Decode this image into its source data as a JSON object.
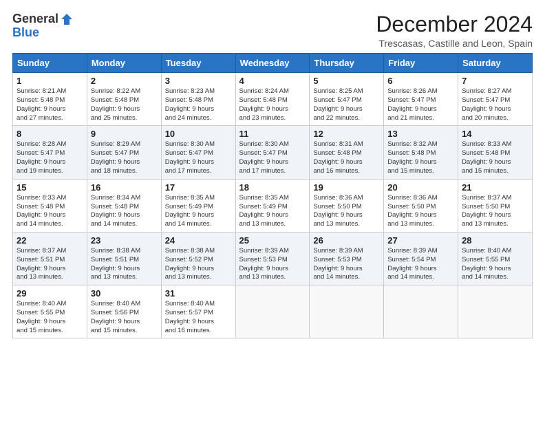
{
  "logo": {
    "general": "General",
    "blue": "Blue"
  },
  "title": "December 2024",
  "subtitle": "Trescasas, Castille and Leon, Spain",
  "weekdays": [
    "Sunday",
    "Monday",
    "Tuesday",
    "Wednesday",
    "Thursday",
    "Friday",
    "Saturday"
  ],
  "weeks": [
    [
      {
        "day": "1",
        "lines": [
          "Sunrise: 8:21 AM",
          "Sunset: 5:48 PM",
          "Daylight: 9 hours",
          "and 27 minutes."
        ]
      },
      {
        "day": "2",
        "lines": [
          "Sunrise: 8:22 AM",
          "Sunset: 5:48 PM",
          "Daylight: 9 hours",
          "and 25 minutes."
        ]
      },
      {
        "day": "3",
        "lines": [
          "Sunrise: 8:23 AM",
          "Sunset: 5:48 PM",
          "Daylight: 9 hours",
          "and 24 minutes."
        ]
      },
      {
        "day": "4",
        "lines": [
          "Sunrise: 8:24 AM",
          "Sunset: 5:48 PM",
          "Daylight: 9 hours",
          "and 23 minutes."
        ]
      },
      {
        "day": "5",
        "lines": [
          "Sunrise: 8:25 AM",
          "Sunset: 5:47 PM",
          "Daylight: 9 hours",
          "and 22 minutes."
        ]
      },
      {
        "day": "6",
        "lines": [
          "Sunrise: 8:26 AM",
          "Sunset: 5:47 PM",
          "Daylight: 9 hours",
          "and 21 minutes."
        ]
      },
      {
        "day": "7",
        "lines": [
          "Sunrise: 8:27 AM",
          "Sunset: 5:47 PM",
          "Daylight: 9 hours",
          "and 20 minutes."
        ]
      }
    ],
    [
      {
        "day": "8",
        "lines": [
          "Sunrise: 8:28 AM",
          "Sunset: 5:47 PM",
          "Daylight: 9 hours",
          "and 19 minutes."
        ]
      },
      {
        "day": "9",
        "lines": [
          "Sunrise: 8:29 AM",
          "Sunset: 5:47 PM",
          "Daylight: 9 hours",
          "and 18 minutes."
        ]
      },
      {
        "day": "10",
        "lines": [
          "Sunrise: 8:30 AM",
          "Sunset: 5:47 PM",
          "Daylight: 9 hours",
          "and 17 minutes."
        ]
      },
      {
        "day": "11",
        "lines": [
          "Sunrise: 8:30 AM",
          "Sunset: 5:47 PM",
          "Daylight: 9 hours",
          "and 17 minutes."
        ]
      },
      {
        "day": "12",
        "lines": [
          "Sunrise: 8:31 AM",
          "Sunset: 5:48 PM",
          "Daylight: 9 hours",
          "and 16 minutes."
        ]
      },
      {
        "day": "13",
        "lines": [
          "Sunrise: 8:32 AM",
          "Sunset: 5:48 PM",
          "Daylight: 9 hours",
          "and 15 minutes."
        ]
      },
      {
        "day": "14",
        "lines": [
          "Sunrise: 8:33 AM",
          "Sunset: 5:48 PM",
          "Daylight: 9 hours",
          "and 15 minutes."
        ]
      }
    ],
    [
      {
        "day": "15",
        "lines": [
          "Sunrise: 8:33 AM",
          "Sunset: 5:48 PM",
          "Daylight: 9 hours",
          "and 14 minutes."
        ]
      },
      {
        "day": "16",
        "lines": [
          "Sunrise: 8:34 AM",
          "Sunset: 5:48 PM",
          "Daylight: 9 hours",
          "and 14 minutes."
        ]
      },
      {
        "day": "17",
        "lines": [
          "Sunrise: 8:35 AM",
          "Sunset: 5:49 PM",
          "Daylight: 9 hours",
          "and 14 minutes."
        ]
      },
      {
        "day": "18",
        "lines": [
          "Sunrise: 8:35 AM",
          "Sunset: 5:49 PM",
          "Daylight: 9 hours",
          "and 13 minutes."
        ]
      },
      {
        "day": "19",
        "lines": [
          "Sunrise: 8:36 AM",
          "Sunset: 5:50 PM",
          "Daylight: 9 hours",
          "and 13 minutes."
        ]
      },
      {
        "day": "20",
        "lines": [
          "Sunrise: 8:36 AM",
          "Sunset: 5:50 PM",
          "Daylight: 9 hours",
          "and 13 minutes."
        ]
      },
      {
        "day": "21",
        "lines": [
          "Sunrise: 8:37 AM",
          "Sunset: 5:50 PM",
          "Daylight: 9 hours",
          "and 13 minutes."
        ]
      }
    ],
    [
      {
        "day": "22",
        "lines": [
          "Sunrise: 8:37 AM",
          "Sunset: 5:51 PM",
          "Daylight: 9 hours",
          "and 13 minutes."
        ]
      },
      {
        "day": "23",
        "lines": [
          "Sunrise: 8:38 AM",
          "Sunset: 5:51 PM",
          "Daylight: 9 hours",
          "and 13 minutes."
        ]
      },
      {
        "day": "24",
        "lines": [
          "Sunrise: 8:38 AM",
          "Sunset: 5:52 PM",
          "Daylight: 9 hours",
          "and 13 minutes."
        ]
      },
      {
        "day": "25",
        "lines": [
          "Sunrise: 8:39 AM",
          "Sunset: 5:53 PM",
          "Daylight: 9 hours",
          "and 13 minutes."
        ]
      },
      {
        "day": "26",
        "lines": [
          "Sunrise: 8:39 AM",
          "Sunset: 5:53 PM",
          "Daylight: 9 hours",
          "and 14 minutes."
        ]
      },
      {
        "day": "27",
        "lines": [
          "Sunrise: 8:39 AM",
          "Sunset: 5:54 PM",
          "Daylight: 9 hours",
          "and 14 minutes."
        ]
      },
      {
        "day": "28",
        "lines": [
          "Sunrise: 8:40 AM",
          "Sunset: 5:55 PM",
          "Daylight: 9 hours",
          "and 14 minutes."
        ]
      }
    ],
    [
      {
        "day": "29",
        "lines": [
          "Sunrise: 8:40 AM",
          "Sunset: 5:55 PM",
          "Daylight: 9 hours",
          "and 15 minutes."
        ]
      },
      {
        "day": "30",
        "lines": [
          "Sunrise: 8:40 AM",
          "Sunset: 5:56 PM",
          "Daylight: 9 hours",
          "and 15 minutes."
        ]
      },
      {
        "day": "31",
        "lines": [
          "Sunrise: 8:40 AM",
          "Sunset: 5:57 PM",
          "Daylight: 9 hours",
          "and 16 minutes."
        ]
      },
      null,
      null,
      null,
      null
    ]
  ]
}
